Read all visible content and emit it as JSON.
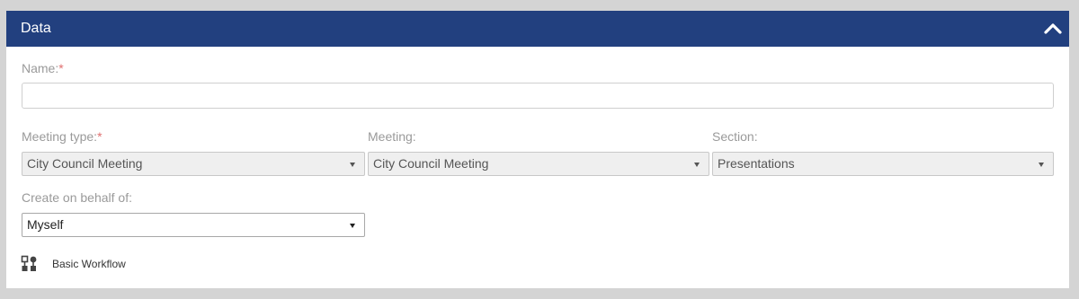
{
  "panel": {
    "title": "Data",
    "collapse_icon": "chevron-up-icon",
    "header_color": "#22407f"
  },
  "fields": {
    "name": {
      "label": "Name:",
      "required_marker": "*",
      "value": ""
    },
    "meeting_type": {
      "label": "Meeting type:",
      "required_marker": "*",
      "value": "City Council Meeting"
    },
    "meeting": {
      "label": "Meeting:",
      "value": "City Council Meeting"
    },
    "section": {
      "label": "Section:",
      "value": "Presentations"
    },
    "behalf": {
      "label": "Create on behalf of:",
      "value": "Myself"
    }
  },
  "workflow": {
    "icon": "workflow-icon",
    "label": "Basic Workflow"
  }
}
